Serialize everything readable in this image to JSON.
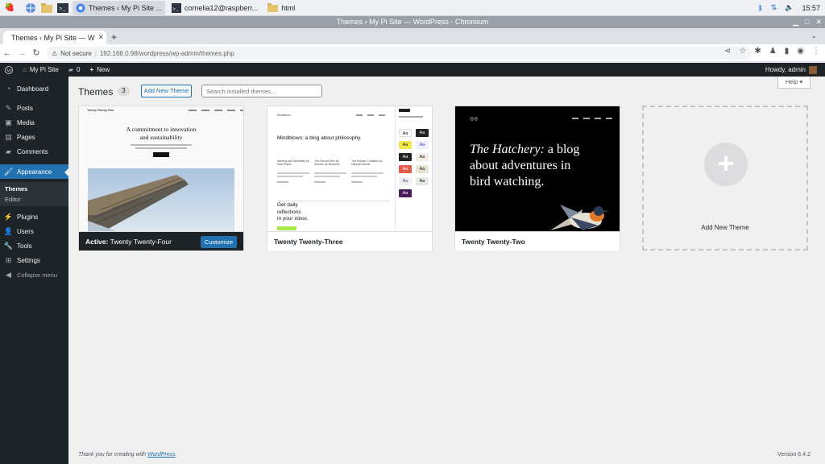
{
  "taskbar": {
    "tasks": [
      {
        "label": "Themes ‹ My Pi Site ..."
      },
      {
        "label": "cornelia12@raspberr..."
      },
      {
        "label": "html"
      }
    ],
    "clock": "15:57"
  },
  "window": {
    "title": "Themes ‹ My Pi Site — WordPress - Chromium"
  },
  "browser": {
    "tab_title": "Themes ‹ My Pi Site — W",
    "security": "Not secure",
    "url": "192.168.0.98/wordpress/wp-admin/themes.php"
  },
  "adminbar": {
    "site_name": "My Pi Site",
    "comments_count": "0",
    "new_label": "New",
    "howdy": "Howdy, admin"
  },
  "sidebar": {
    "items": [
      {
        "label": "Dashboard",
        "icon": "dashboard-icon"
      },
      {
        "label": "Posts",
        "icon": "pin-icon"
      },
      {
        "label": "Media",
        "icon": "media-icon"
      },
      {
        "label": "Pages",
        "icon": "page-icon"
      },
      {
        "label": "Comments",
        "icon": "comment-icon"
      },
      {
        "label": "Appearance",
        "icon": "brush-icon"
      },
      {
        "label": "Plugins",
        "icon": "plugin-icon"
      },
      {
        "label": "Users",
        "icon": "users-icon"
      },
      {
        "label": "Tools",
        "icon": "wrench-icon"
      },
      {
        "label": "Settings",
        "icon": "settings-icon"
      },
      {
        "label": "Collapse menu",
        "icon": "collapse-icon"
      }
    ],
    "appearance_sub": [
      {
        "label": "Themes"
      },
      {
        "label": "Editor"
      }
    ]
  },
  "main": {
    "title": "Themes",
    "count": "3",
    "add_new_label": "Add New Theme",
    "search_placeholder": "Search installed themes...",
    "help_label": "Help ▾"
  },
  "themes": [
    {
      "active_label": "Active:",
      "name": "Twenty Twenty-Four",
      "action": "Customize"
    },
    {
      "name": "Twenty Twenty-Three"
    },
    {
      "name": "Twenty Twenty-Two"
    }
  ],
  "add_card": {
    "label": "Add New Theme"
  },
  "previews": {
    "tt4": {
      "site": "Twenty Twenty-Four",
      "headline1": "A commitment to innovation",
      "headline2": "and sustainability"
    },
    "tt3": {
      "site": "Mindblown",
      "headline": "Mindblown: a blog about philosophy.",
      "get": [
        "Get daily",
        "reflections",
        "in your inbox."
      ],
      "books": [
        "Naming and Necessity by Saul Kripke",
        "The Second Sex by Simone de Beauvoir",
        "The Human Condition by Hannah Arendt"
      ]
    },
    "tt2": {
      "headline_em": "The Hatchery:",
      "headline1": " a blog",
      "headline2": "about adventures in",
      "headline3": "bird watching."
    }
  },
  "footer": {
    "thanks_prefix": "Thank you for creating with ",
    "thanks_link": "WordPress",
    "thanks_suffix": ".",
    "version": "Version 6.4.2"
  },
  "colors": {
    "accent": "#2271b1",
    "admin_dark": "#1d2327",
    "sidebar_sub": "#2c3338"
  }
}
